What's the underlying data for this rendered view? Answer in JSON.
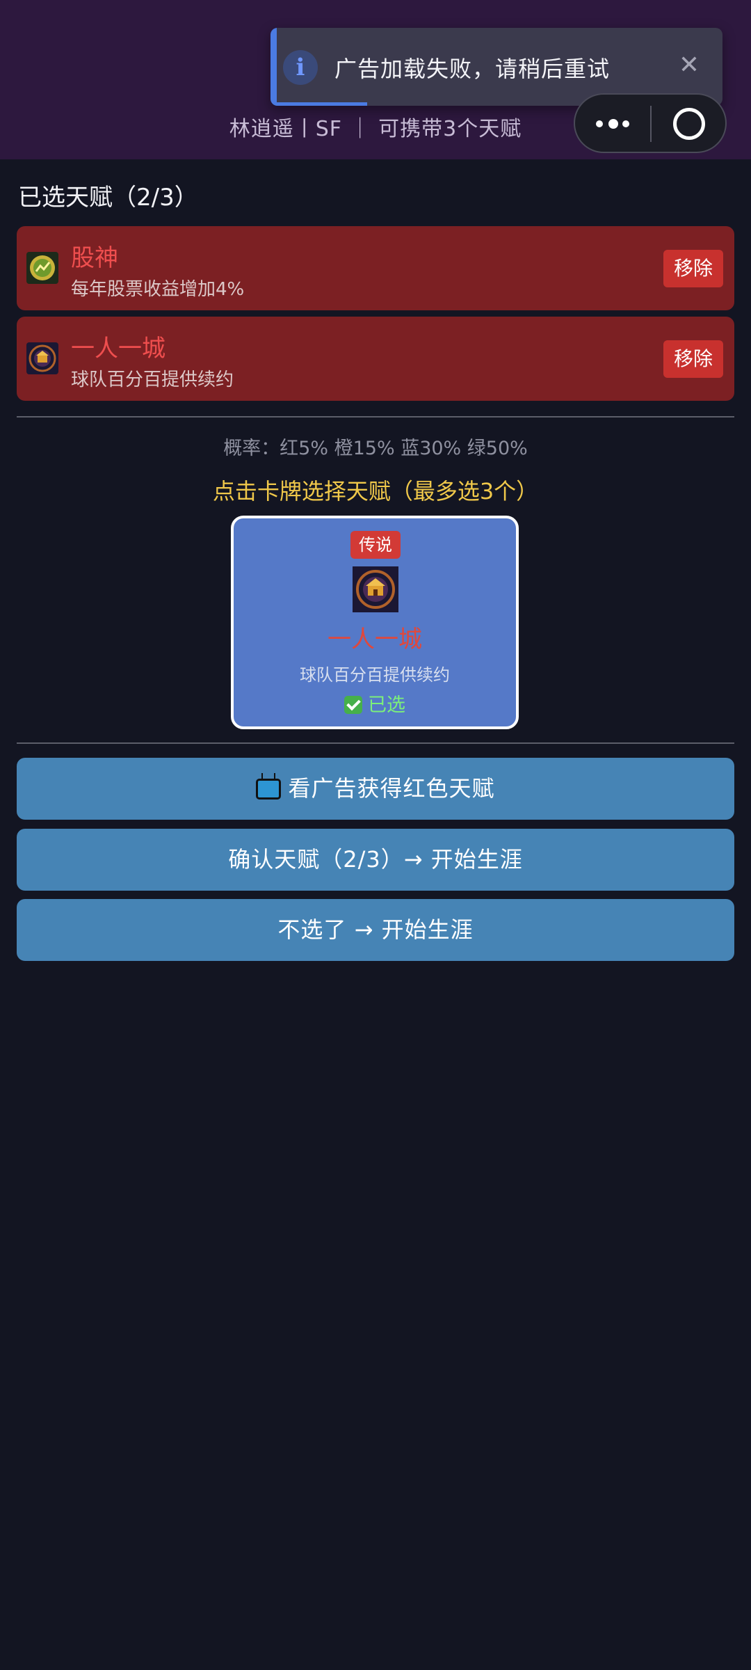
{
  "toast": {
    "message": "广告加载失败，请稍后重试",
    "icon": "info-icon",
    "close_icon": "close-icon"
  },
  "header": {
    "subtitle": "林逍遥丨SF ｜ 可携带3个天赋"
  },
  "selected_section": {
    "title": "已选天赋（2/3）",
    "items": [
      {
        "name": "股神",
        "desc": "每年股票收益增加4%",
        "remove_label": "移除",
        "icon": "stock-god-icon"
      },
      {
        "name": "一人一城",
        "desc": "球队百分百提供续约",
        "remove_label": "移除",
        "icon": "one-city-icon"
      }
    ]
  },
  "probability_text": "概率：红5% 橙15% 蓝30% 绿50%",
  "pick_hint": "点击卡牌选择天赋（最多选3个）",
  "choice_card": {
    "rarity": "传说",
    "name": "一人一城",
    "desc": "球队百分百提供续约",
    "selected_label": "已选",
    "icon": "one-city-icon"
  },
  "actions": {
    "watch_ad_label": "看广告获得红色天赋",
    "confirm_label": "确认天赋（2/3）→ 开始生涯",
    "skip_label": "不选了 → 开始生涯"
  },
  "colors": {
    "header_bg": "#2d183e",
    "page_bg": "#131522",
    "selected_card_bg": "#7c2023",
    "choice_card_bg": "#5579c8",
    "button_bg": "#4684b5",
    "hint_color": "#f0c84a"
  }
}
